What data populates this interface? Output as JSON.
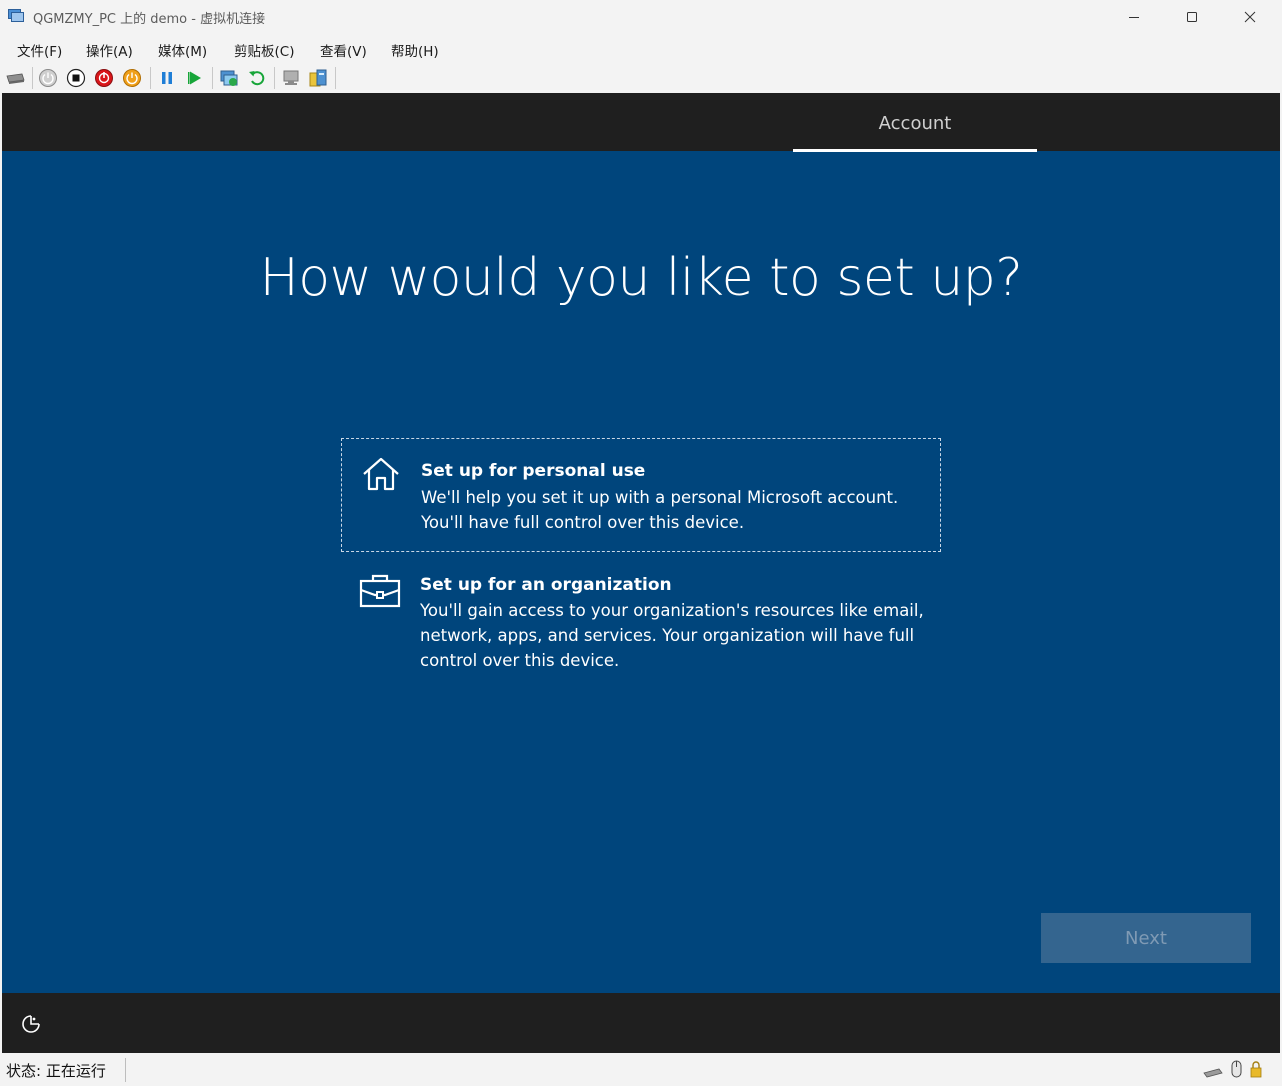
{
  "window": {
    "title": "QGMZMY_PC 上的 demo - 虚拟机连接"
  },
  "menu": [
    "文件(F)",
    "操作(A)",
    "媒体(M)",
    "剪贴板(C)",
    "查看(V)",
    "帮助(H)"
  ],
  "toolbar": {
    "icons": [
      "ctrl-alt-del-icon",
      "start-icon",
      "turn-off-icon",
      "shutdown-icon",
      "power-icon",
      "pause-icon",
      "resume-icon",
      "checkpoint-icon",
      "revert-icon",
      "enhanced-session-icon",
      "share-icon"
    ]
  },
  "oobe": {
    "tab_label": "Account",
    "heading": "How would you like to set up?",
    "options": [
      {
        "title": "Set up for personal use",
        "description": "We'll help you set it up with a personal Microsoft account. You'll have full control over this device.",
        "icon": "home-icon",
        "selected": true
      },
      {
        "title": "Set up for an organization",
        "description": "You'll gain access to your organization's resources like email, network, apps, and services. Your organization will have full control over this device.",
        "icon": "briefcase-icon",
        "selected": false
      }
    ],
    "next_label": "Next",
    "next_enabled": false
  },
  "status": {
    "text": "状态: 正在运行"
  },
  "colors": {
    "oobe_background": "#00457c",
    "band_background": "#1f1f1f",
    "next_button_disabled": "#34658f"
  }
}
